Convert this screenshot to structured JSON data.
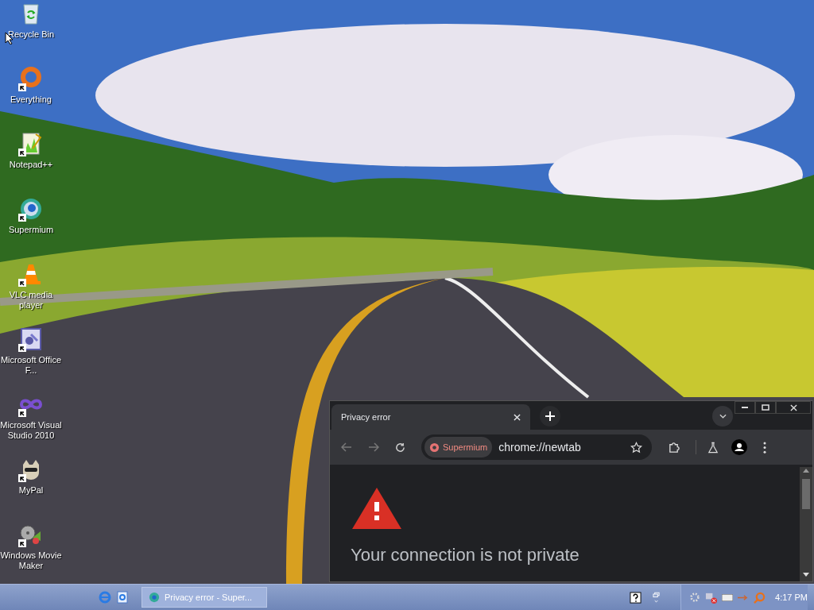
{
  "desktop_icons": [
    {
      "label": "Recycle Bin",
      "shortcut": false
    },
    {
      "label": "Everything",
      "shortcut": true
    },
    {
      "label": "Notepad++",
      "shortcut": true
    },
    {
      "label": "Supermium",
      "shortcut": true
    },
    {
      "label": "VLC media player",
      "shortcut": true
    },
    {
      "label": "Microsoft Office F...",
      "shortcut": true
    },
    {
      "label": "Microsoft Visual Studio 2010",
      "shortcut": true
    },
    {
      "label": "MyPal",
      "shortcut": true
    },
    {
      "label": "Windows Movie Maker",
      "shortcut": true
    }
  ],
  "browser": {
    "tabs": [
      {
        "title": "Privacy error",
        "selected": true
      }
    ],
    "address": {
      "chip": "Supermium",
      "url": "chrome://newtab"
    },
    "page": {
      "heading": "Your connection is not private"
    }
  },
  "taskbar": {
    "tasks": [
      {
        "label": "Privacy error - Super..."
      }
    ],
    "clock": "4:17 PM"
  }
}
